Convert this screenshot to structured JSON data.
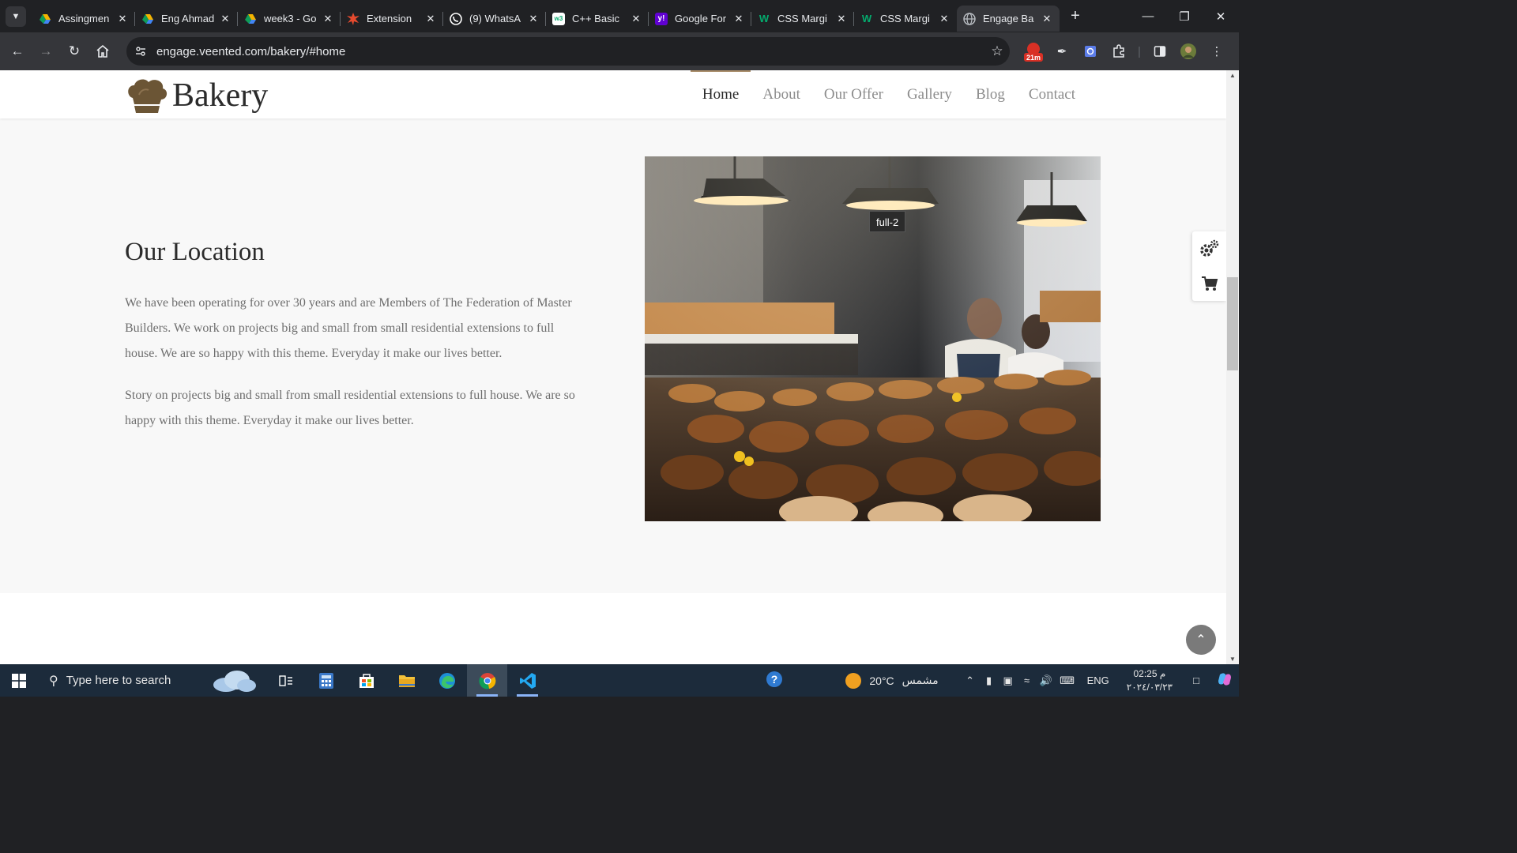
{
  "browser": {
    "tabs": [
      {
        "title": "Assingmen",
        "icon": "google-drive-icon",
        "active": false
      },
      {
        "title": "Eng Ahmad",
        "icon": "google-drive-icon",
        "active": false
      },
      {
        "title": "week3 - Go",
        "icon": "google-drive-icon",
        "active": false
      },
      {
        "title": "Extension",
        "icon": "extension-burst-icon",
        "active": false
      },
      {
        "title": "(9) WhatsA",
        "icon": "whatsapp-icon",
        "active": false
      },
      {
        "title": "C++ Basic",
        "icon": "w3schools-icon",
        "active": false
      },
      {
        "title": "Google For",
        "icon": "yahoo-icon",
        "active": false
      },
      {
        "title": "CSS Margi",
        "icon": "w3schools-green-icon",
        "active": false
      },
      {
        "title": "CSS Margi",
        "icon": "w3schools-green-icon",
        "active": false
      },
      {
        "title": "Engage Ba",
        "icon": "globe-icon",
        "active": true
      }
    ],
    "close_glyph": "✕",
    "new_tab_glyph": "+",
    "url": "engage.veented.com/bakery/#home",
    "ext_badge": "21m"
  },
  "site": {
    "logo_text": "Bakery",
    "nav": [
      {
        "label": "Home",
        "active": true
      },
      {
        "label": "About",
        "active": false
      },
      {
        "label": "Our Offer",
        "active": false
      },
      {
        "label": "Gallery",
        "active": false
      },
      {
        "label": "Blog",
        "active": false
      },
      {
        "label": "Contact",
        "active": false
      }
    ],
    "section_title": "Our Location",
    "paragraph_1": "We have been operating for over 30 years and are Members of The Federation of Master Builders. We work on projects big and small from small residential extensions to full house. We are so happy with this theme. Everyday it make our lives better.",
    "paragraph_2": "Story on projects big and small from small residential extensions to full house. We are so happy with this theme. Everyday it make our lives better.",
    "image_tooltip": "full-2"
  },
  "taskbar": {
    "search_placeholder": "Type here to search",
    "weather_temp": "20°C",
    "weather_text": "مشمس",
    "language": "ENG",
    "time": "02:25 م",
    "date": "٢٠٢٤/٠٣/٢٣"
  },
  "colors": {
    "accent": "#a98d6a",
    "heading": "#2b2b2b",
    "body_text": "#6e6e6e",
    "page_bg": "#f8f8f8"
  }
}
